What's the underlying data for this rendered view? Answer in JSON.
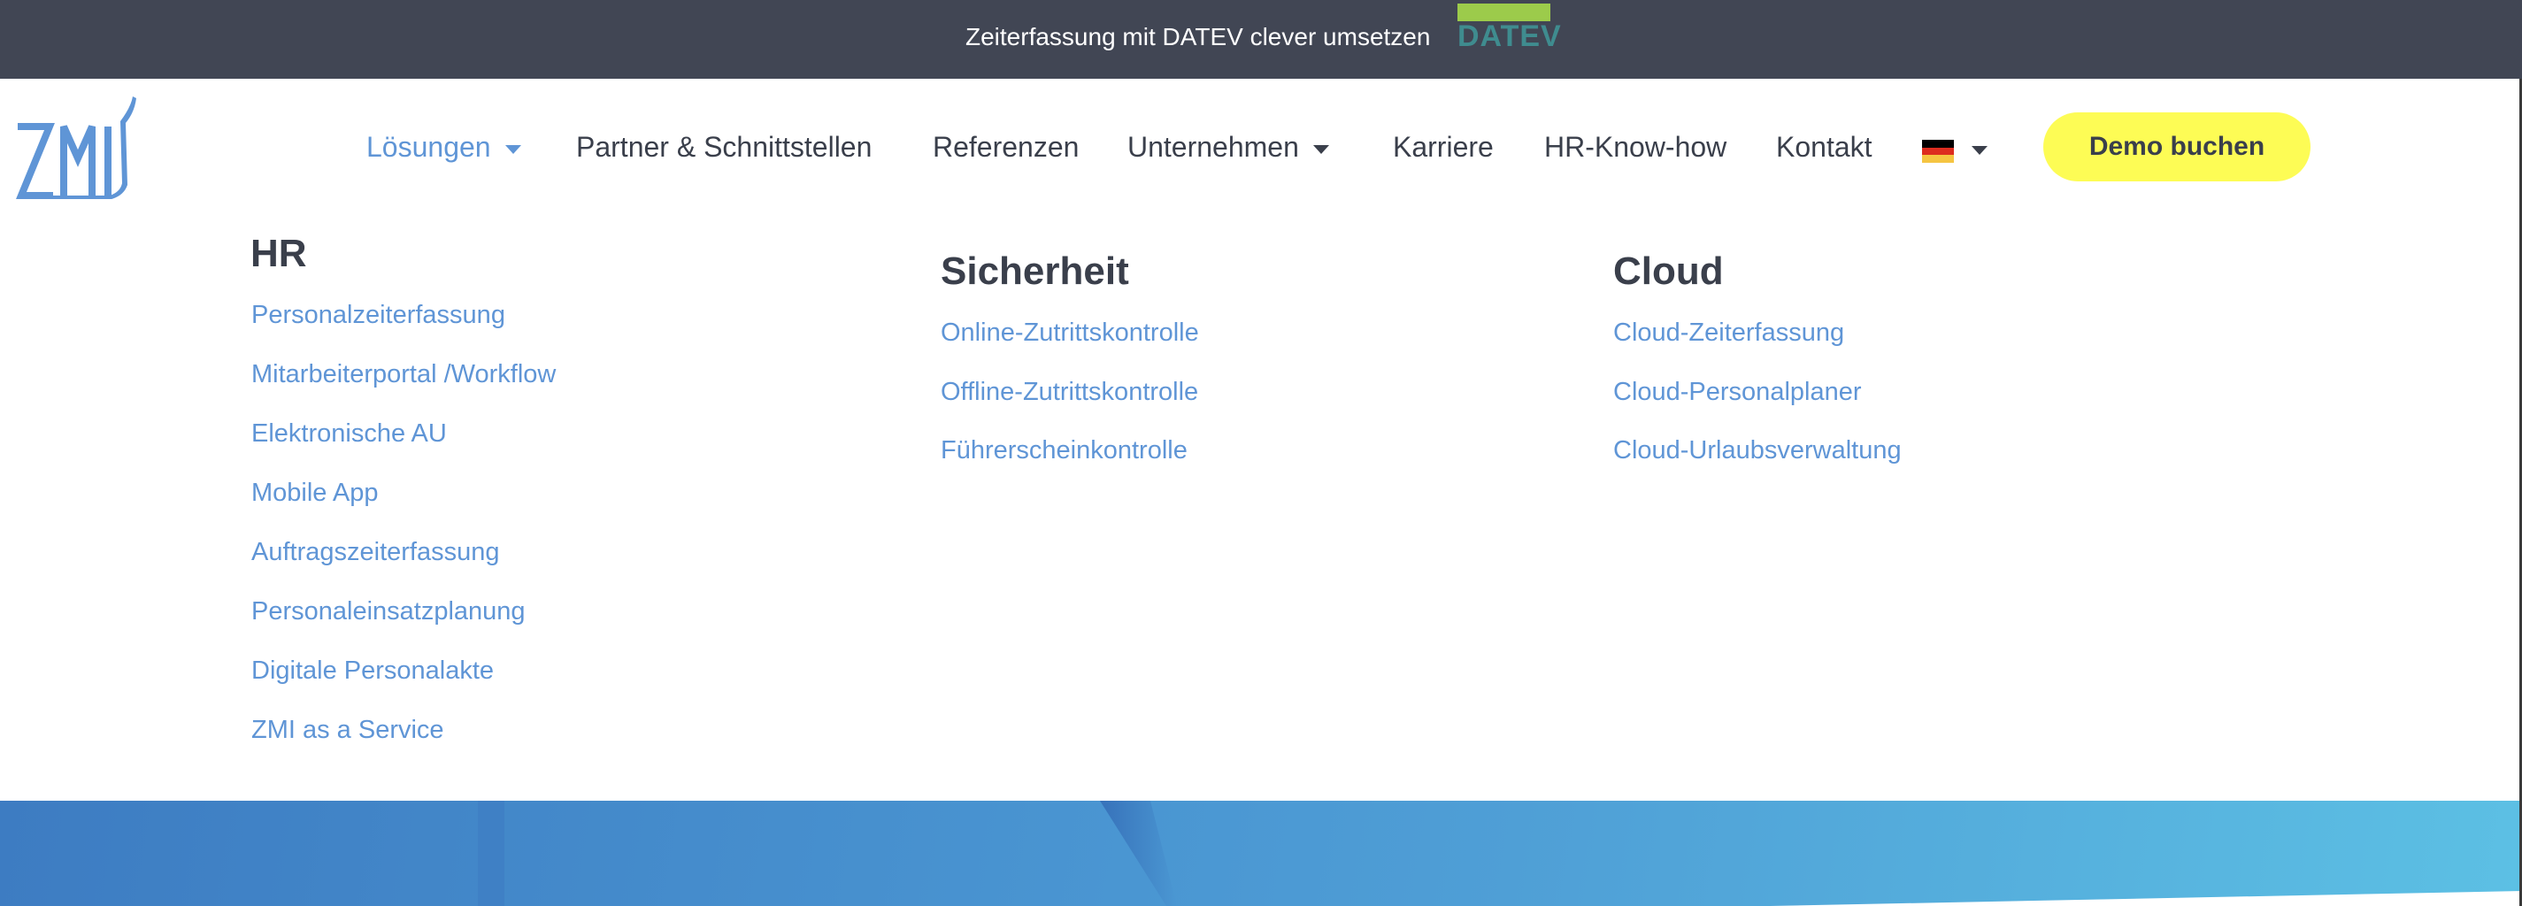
{
  "banner": {
    "text": "Zeiterfassung mit DATEV clever umsetzen",
    "datev_logo": "DATEV"
  },
  "header": {
    "logo": "ZMI",
    "nav": [
      {
        "label": "Lösungen",
        "dropdown": true,
        "active": true
      },
      {
        "label": "Partner & Schnittstellen"
      },
      {
        "label": "Referenzen"
      },
      {
        "label": "Unternehmen",
        "dropdown": true
      },
      {
        "label": "Karriere"
      },
      {
        "label": "HR-Know-how"
      },
      {
        "label": "Kontakt"
      }
    ],
    "language": "de-flag-icon",
    "demo_button": "Demo buchen"
  },
  "mega_menu": {
    "columns": [
      {
        "title": "HR",
        "items": [
          "Personalzeiterfassung",
          "Mitarbeiterportal /Workflow",
          "Elektronische AU",
          "Mobile App",
          "Auftragszeiterfassung",
          "Personaleinsatzplanung",
          "Digitale Personalakte",
          "ZMI as a Service"
        ]
      },
      {
        "title": "Sicherheit",
        "items": [
          "Online-Zutrittskontrolle",
          "Offline-Zutrittskontrolle",
          "Führerscheinkontrolle"
        ]
      },
      {
        "title": "Cloud",
        "items": [
          "Cloud-Zeiterfassung",
          "Cloud-Personalplaner",
          "Cloud-Urlaubsverwaltung"
        ]
      }
    ]
  },
  "colors": {
    "banner": "#414654",
    "accent": "#5f95d6",
    "text": "#3a3f4b",
    "cta": "#fdfc55",
    "datev_green": "#9ccb4b"
  }
}
